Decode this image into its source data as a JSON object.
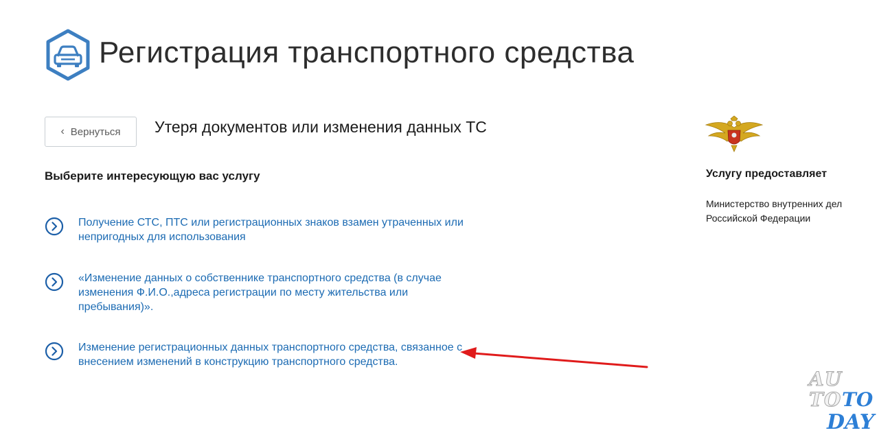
{
  "header": {
    "title": "Регистрация транспортного средства",
    "icon": "car-icon",
    "accent_color": "#3d7fc1"
  },
  "toolbar": {
    "back_label": "Вернуться",
    "back_icon": "chevron-left-icon"
  },
  "section": {
    "title": "Утеря документов или изменения данных ТС"
  },
  "services": {
    "heading": "Выберите интересующую вас услугу",
    "link_color": "#1c6bb3",
    "items": [
      {
        "label": "Получение СТС, ПТС или регистрационных знаков взамен утраченных или непригодных для использования"
      },
      {
        "label": "«Изменение данных о собственнике транспортного средства (в случае изменения Ф.И.О.,адреса регистрации по месту жительства или пребывания)»."
      },
      {
        "label": "Изменение регистрационных данных транспортного средства, связанное с внесением изменений в конструкцию транспортного средства."
      }
    ]
  },
  "provider": {
    "label": "Услугу предоставляет",
    "name": "Министерство внутренних дел Российской Федерации",
    "emblem": "eagle-emblem-icon"
  },
  "annotation": {
    "arrow_color": "#e01b1b"
  },
  "watermark": {
    "line1": "AU",
    "line2a": "TO",
    "line2b": "TO",
    "line3": "DAY"
  }
}
